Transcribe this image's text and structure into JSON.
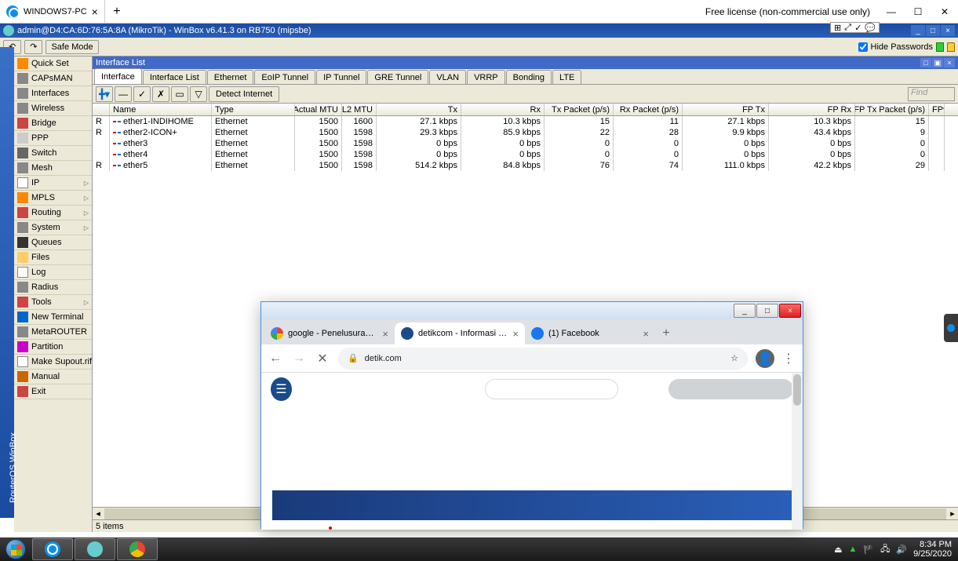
{
  "teamviewer": {
    "tab_label": "WINDOWS7-PC",
    "license": "Free license (non-commercial use only)"
  },
  "winbox": {
    "title": "admin@D4:CA:6D:76:5A:8A (MikroTik) - WinBox v6.41.3 on RB750 (mipsbe)",
    "safe_mode": "Safe Mode",
    "hide_passwords": "Hide Passwords",
    "vertical_label": "RouterOS WinBox"
  },
  "sidebar": [
    {
      "label": "Quick Set",
      "cls": "ico-set",
      "arrow": false
    },
    {
      "label": "CAPsMAN",
      "cls": "ico-cap",
      "arrow": false
    },
    {
      "label": "Interfaces",
      "cls": "ico-int",
      "arrow": false
    },
    {
      "label": "Wireless",
      "cls": "ico-wifi",
      "arrow": false
    },
    {
      "label": "Bridge",
      "cls": "ico-br",
      "arrow": false
    },
    {
      "label": "PPP",
      "cls": "ico-ppp",
      "arrow": false
    },
    {
      "label": "Switch",
      "cls": "ico-sw",
      "arrow": false
    },
    {
      "label": "Mesh",
      "cls": "ico-mesh",
      "arrow": false
    },
    {
      "label": "IP",
      "cls": "ico-ip",
      "arrow": true
    },
    {
      "label": "MPLS",
      "cls": "ico-mpls",
      "arrow": true
    },
    {
      "label": "Routing",
      "cls": "ico-rt",
      "arrow": true
    },
    {
      "label": "System",
      "cls": "ico-sys",
      "arrow": true
    },
    {
      "label": "Queues",
      "cls": "ico-q",
      "arrow": false
    },
    {
      "label": "Files",
      "cls": "ico-fi",
      "arrow": false
    },
    {
      "label": "Log",
      "cls": "ico-log",
      "arrow": false
    },
    {
      "label": "Radius",
      "cls": "ico-rad",
      "arrow": false
    },
    {
      "label": "Tools",
      "cls": "ico-tool",
      "arrow": true
    },
    {
      "label": "New Terminal",
      "cls": "ico-nt",
      "arrow": false
    },
    {
      "label": "MetaROUTER",
      "cls": "ico-mr",
      "arrow": false
    },
    {
      "label": "Partition",
      "cls": "ico-pt",
      "arrow": false
    },
    {
      "label": "Make Supout.rif",
      "cls": "ico-ms",
      "arrow": false
    },
    {
      "label": "Manual",
      "cls": "ico-man",
      "arrow": false
    },
    {
      "label": "Exit",
      "cls": "ico-ex",
      "arrow": false
    }
  ],
  "interface_list": {
    "title": "Interface List",
    "tabs": [
      "Interface",
      "Interface List",
      "Ethernet",
      "EoIP Tunnel",
      "IP Tunnel",
      "GRE Tunnel",
      "VLAN",
      "VRRP",
      "Bonding",
      "LTE"
    ],
    "active_tab": 0,
    "detect": "Detect Internet",
    "find_placeholder": "Find",
    "columns": [
      "",
      "Name",
      "Type",
      "Actual MTU",
      "L2 MTU",
      "Tx",
      "Rx",
      "Tx Packet (p/s)",
      "Rx Packet (p/s)",
      "FP Tx",
      "FP Rx",
      "FP Tx Packet (p/s)",
      "FP▾"
    ],
    "rows": [
      {
        "flag": "R",
        "name": "ether1-INDIHOME",
        "type": "Ethernet",
        "mtu": "1500",
        "l2": "1600",
        "tx": "27.1 kbps",
        "rx": "10.3 kbps",
        "txp": "15",
        "rxp": "11",
        "fptx": "27.1 kbps",
        "fprx": "10.3 kbps",
        "fptxp": "15"
      },
      {
        "flag": "R",
        "name": "ether2-ICON+",
        "type": "Ethernet",
        "mtu": "1500",
        "l2": "1598",
        "tx": "29.3 kbps",
        "rx": "85.9 kbps",
        "txp": "22",
        "rxp": "28",
        "fptx": "9.9 kbps",
        "fprx": "43.4 kbps",
        "fptxp": "9"
      },
      {
        "flag": "",
        "name": "ether3",
        "type": "Ethernet",
        "mtu": "1500",
        "l2": "1598",
        "tx": "0 bps",
        "rx": "0 bps",
        "txp": "0",
        "rxp": "0",
        "fptx": "0 bps",
        "fprx": "0 bps",
        "fptxp": "0"
      },
      {
        "flag": "",
        "name": "ether4",
        "type": "Ethernet",
        "mtu": "1500",
        "l2": "1598",
        "tx": "0 bps",
        "rx": "0 bps",
        "txp": "0",
        "rxp": "0",
        "fptx": "0 bps",
        "fprx": "0 bps",
        "fptxp": "0"
      },
      {
        "flag": "R",
        "name": "ether5",
        "type": "Ethernet",
        "mtu": "1500",
        "l2": "1598",
        "tx": "514.2 kbps",
        "rx": "84.8 kbps",
        "txp": "76",
        "rxp": "74",
        "fptx": "111.0 kbps",
        "fprx": "42.2 kbps",
        "fptxp": "29"
      }
    ],
    "status": "5 items"
  },
  "chrome": {
    "tabs": [
      {
        "label": "google - Penelusuran G",
        "fav": "fav-g",
        "active": false
      },
      {
        "label": "detikcom - Informasi Be",
        "fav": "fav-d",
        "active": true
      },
      {
        "label": "(1) Facebook",
        "fav": "fav-f",
        "active": false
      }
    ],
    "url": "detik.com"
  },
  "taskbar": {
    "time": "8:34 PM",
    "date": "9/25/2020"
  }
}
